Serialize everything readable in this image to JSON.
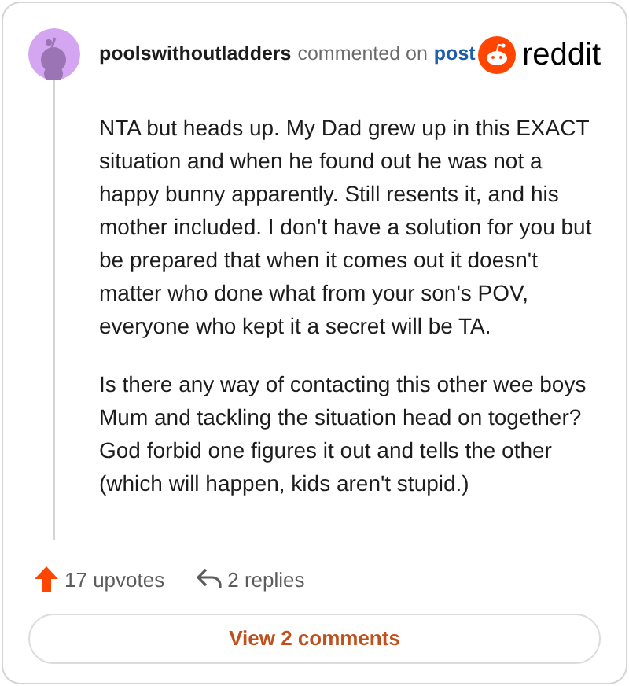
{
  "comment": {
    "author": "poolswithoutladders",
    "action": "commented on",
    "link": "post",
    "brand": "reddit",
    "paragraphs": [
      "NTA but heads up. My Dad grew up in this EXACT situation and when he found out he was not a happy bunny apparently. Still resents it, and his mother included. I don't have a solution for you but be prepared that when it comes out it doesn't matter who done what from your son's POV, everyone who kept it a secret will be TA.",
      "Is there any way of contacting this other wee boys Mum and tackling the situation head on together? God forbid one figures it out and tells the other (which will happen, kids aren't stupid.)"
    ],
    "upvotes": "17 upvotes",
    "replies": "2 replies"
  },
  "button": "View 2 comments"
}
